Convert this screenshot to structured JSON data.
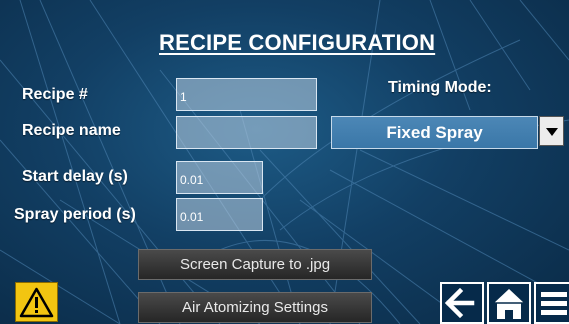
{
  "screen": {
    "title": "RECIPE CONFIGURATION"
  },
  "form": {
    "recipe_number": {
      "label": "Recipe #",
      "value": "1"
    },
    "recipe_name": {
      "label": "Recipe name",
      "value": ""
    },
    "start_delay": {
      "label": "Start delay (s)",
      "value": "0.01"
    },
    "spray_period": {
      "label": "Spray period (s)",
      "value": "0.01"
    }
  },
  "timing_mode": {
    "label": "Timing Mode:",
    "selected": "Fixed Spray"
  },
  "buttons": {
    "screen_capture": "Screen Capture to .jpg",
    "air_atomizing": "Air Atomizing Settings"
  },
  "icons": {
    "alarm": "warning-icon",
    "back": "back-arrow-icon",
    "home": "home-icon",
    "menu": "menu-icon"
  },
  "colors": {
    "background": "#123f64",
    "field": "#a9c2d8",
    "select": "#3f7cad",
    "button": "#333333",
    "warning": "#f2c511"
  }
}
